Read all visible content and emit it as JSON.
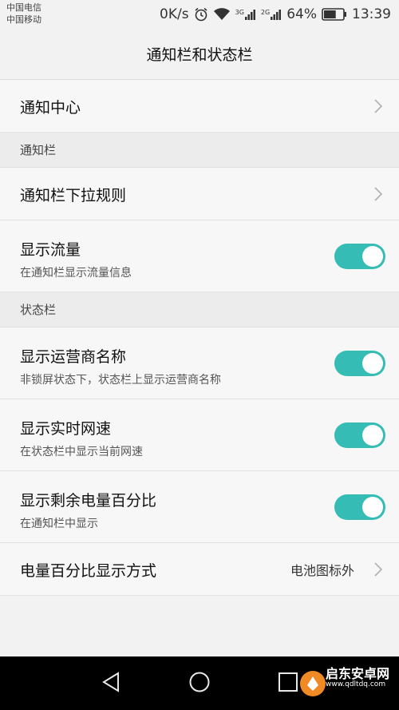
{
  "status_bar": {
    "carrier1": "中国电信",
    "carrier2": "中国移动",
    "net_speed": "0K/s",
    "net_3g": "3G",
    "net_2g": "2G",
    "battery_pct": "64%",
    "battery_level": 0.64,
    "time": "13:39"
  },
  "header": {
    "title": "通知栏和状态栏"
  },
  "rows": {
    "notification_center": {
      "title": "通知中心"
    },
    "section_notification": {
      "label": "通知栏"
    },
    "pulldown_rules": {
      "title": "通知栏下拉规则"
    },
    "show_traffic": {
      "title": "显示流量",
      "subtitle": "在通知栏显示流量信息",
      "enabled": true
    },
    "section_status": {
      "label": "状态栏"
    },
    "show_carrier": {
      "title": "显示运营商名称",
      "subtitle": "非锁屏状态下，状态栏上显示运营商名称",
      "enabled": true
    },
    "show_speed": {
      "title": "显示实时网速",
      "subtitle": "在状态栏中显示当前网速",
      "enabled": true
    },
    "show_battery_pct": {
      "title": "显示剩余电量百分比",
      "subtitle": "在通知栏中显示",
      "enabled": true
    },
    "battery_mode": {
      "title": "电量百分比显示方式",
      "value": "电池图标外"
    }
  },
  "watermark": {
    "text": "启东安卓网",
    "url": "www.qdltdq.com"
  },
  "colors": {
    "accent": "#35bdb5",
    "background": "#f2f2f2",
    "navbar": "#000000"
  }
}
